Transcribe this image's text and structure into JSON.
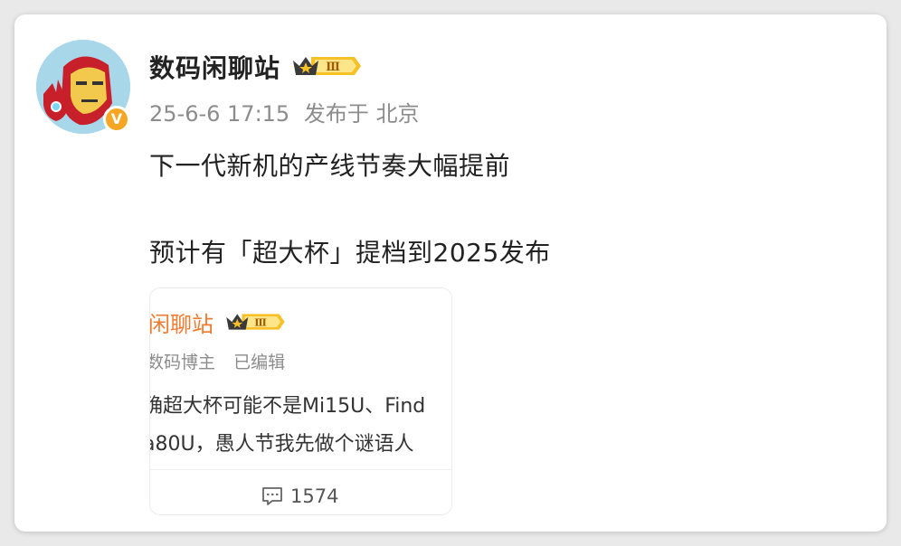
{
  "post": {
    "author_name": "数码闲聊站",
    "vip_level": "Ⅲ",
    "verified_badge": "V",
    "timestamp": "25-6-6 17:15",
    "published_at_label": "发布于 北京",
    "content_lines": [
      "下一代新机的产线节奏大幅提前",
      "预计有「超大杯」提档到2025发布"
    ]
  },
  "repost": {
    "author_name": "闲聊站",
    "vip_level": "Ⅲ",
    "author_role": "数码博主",
    "edited_label": "已编辑",
    "text_lines": [
      "确超大杯可能不是Mi15U、Find",
      "a80U，愚人节我先做个谜语人"
    ],
    "comment_count": "1574"
  },
  "colors": {
    "accent_orange": "#f07a2d",
    "vip_gold": "#f6c026",
    "badge_orange": "#f6a623"
  },
  "icons": {
    "avatar": "ironman-avatar-icon",
    "verified": "verified-v-icon",
    "vip": "crown-vip-icon",
    "comment": "comment-bubble-icon"
  }
}
